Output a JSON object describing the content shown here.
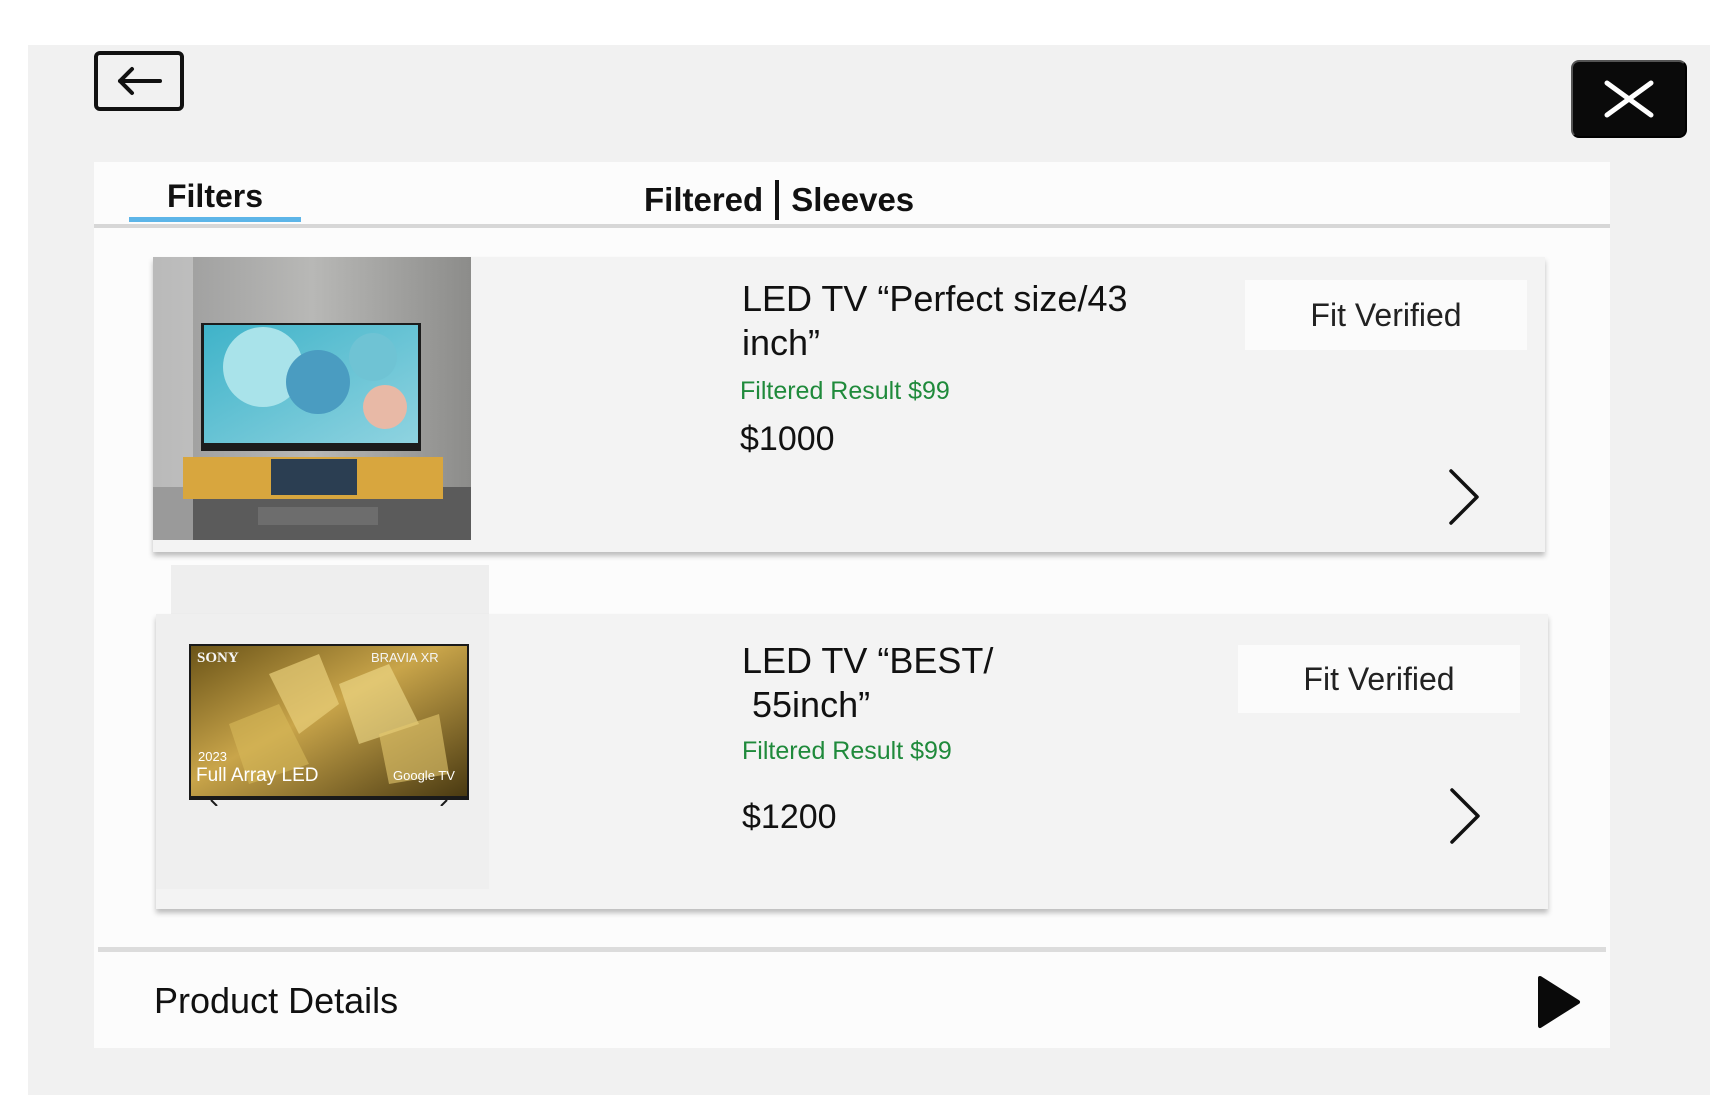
{
  "header": {
    "back_icon": "arrow-left-icon",
    "close_icon": "close-x-icon"
  },
  "tabs": {
    "filters_label": "Filters",
    "title_left": "Filtered",
    "title_right": "Sleeves"
  },
  "products": [
    {
      "title": "LED TV  “Perfect size/43 inch”",
      "filtered_result": "Filtered Result  $99",
      "price": "$1000",
      "badge": "Fit Verified"
    },
    {
      "title_line1": "LED TV “BEST/",
      "title_line2": " 55inch”",
      "filtered_result": "Filtered Result  $99",
      "price": "$1200",
      "badge": "Fit Verified",
      "image_text": {
        "brand": "SONY",
        "series": "BRAVIA XR",
        "year": "2023",
        "tagline": "Full Array LED",
        "platform": "Google TV"
      }
    }
  ],
  "footer": {
    "details_label": "Product Details"
  },
  "colors": {
    "accent_underline": "#5db5e8",
    "filtered_green": "#1f8a3b",
    "close_button_bg": "#0a0a0a"
  }
}
